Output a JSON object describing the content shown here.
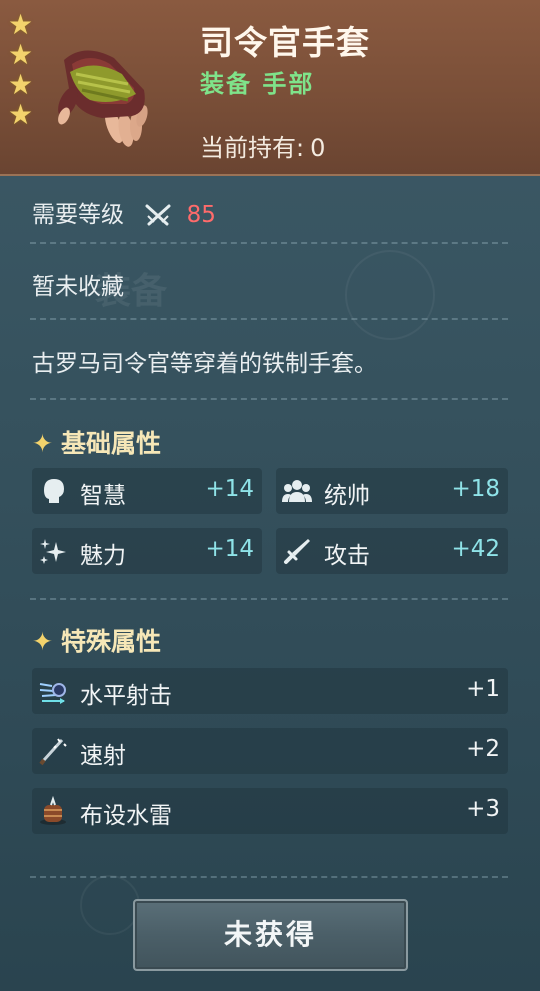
{
  "item": {
    "name": "司令官手套",
    "category": "装备 手部",
    "owned_label": "当前持有:",
    "owned_count": "0",
    "stars": 4
  },
  "requirement": {
    "label": "需要等级",
    "icon": "crossed-swords-icon",
    "level": "85",
    "level_color": "#ff6b6b"
  },
  "collection_status": "暂未收藏",
  "description": "古罗马司令官等穿着的铁制手套。",
  "basic_attributes": {
    "title": "基础属性",
    "items": [
      {
        "icon": "head-icon",
        "name": "智慧",
        "value": "+14"
      },
      {
        "icon": "group-icon",
        "name": "统帅",
        "value": "+18"
      },
      {
        "icon": "sparkle-icon",
        "name": "魅力",
        "value": "+14"
      },
      {
        "icon": "sword-icon",
        "name": "攻击",
        "value": "+42"
      }
    ]
  },
  "special_attributes": {
    "title": "特殊属性",
    "items": [
      {
        "icon": "horizontal-shot-icon",
        "name": "水平射击",
        "value": "+1"
      },
      {
        "icon": "rapid-fire-icon",
        "name": "速射",
        "value": "+2"
      },
      {
        "icon": "mine-barrel-icon",
        "name": "布设水雷",
        "value": "+3"
      }
    ]
  },
  "action_button": "未获得",
  "colors": {
    "header": "#7a4f38",
    "panel": "#36525e",
    "star": "#f3d36c",
    "category": "#7fe38a",
    "stat_value": "#8fe3e8"
  }
}
